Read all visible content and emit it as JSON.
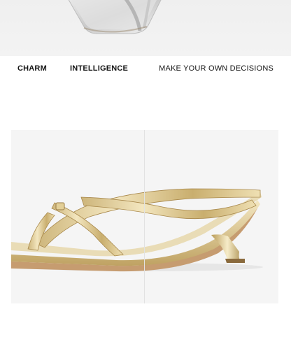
{
  "feature_band": {
    "tags": [
      "CHARM",
      "INTELLIGENCE"
    ],
    "slogan": "MAKE YOUR OWN DECISIONS"
  },
  "colors": {
    "background": "#ffffff",
    "photo_background": "#f5f5f5",
    "text": "#141414",
    "gold": "#d8c48a",
    "silver": "#d9d9d9"
  }
}
